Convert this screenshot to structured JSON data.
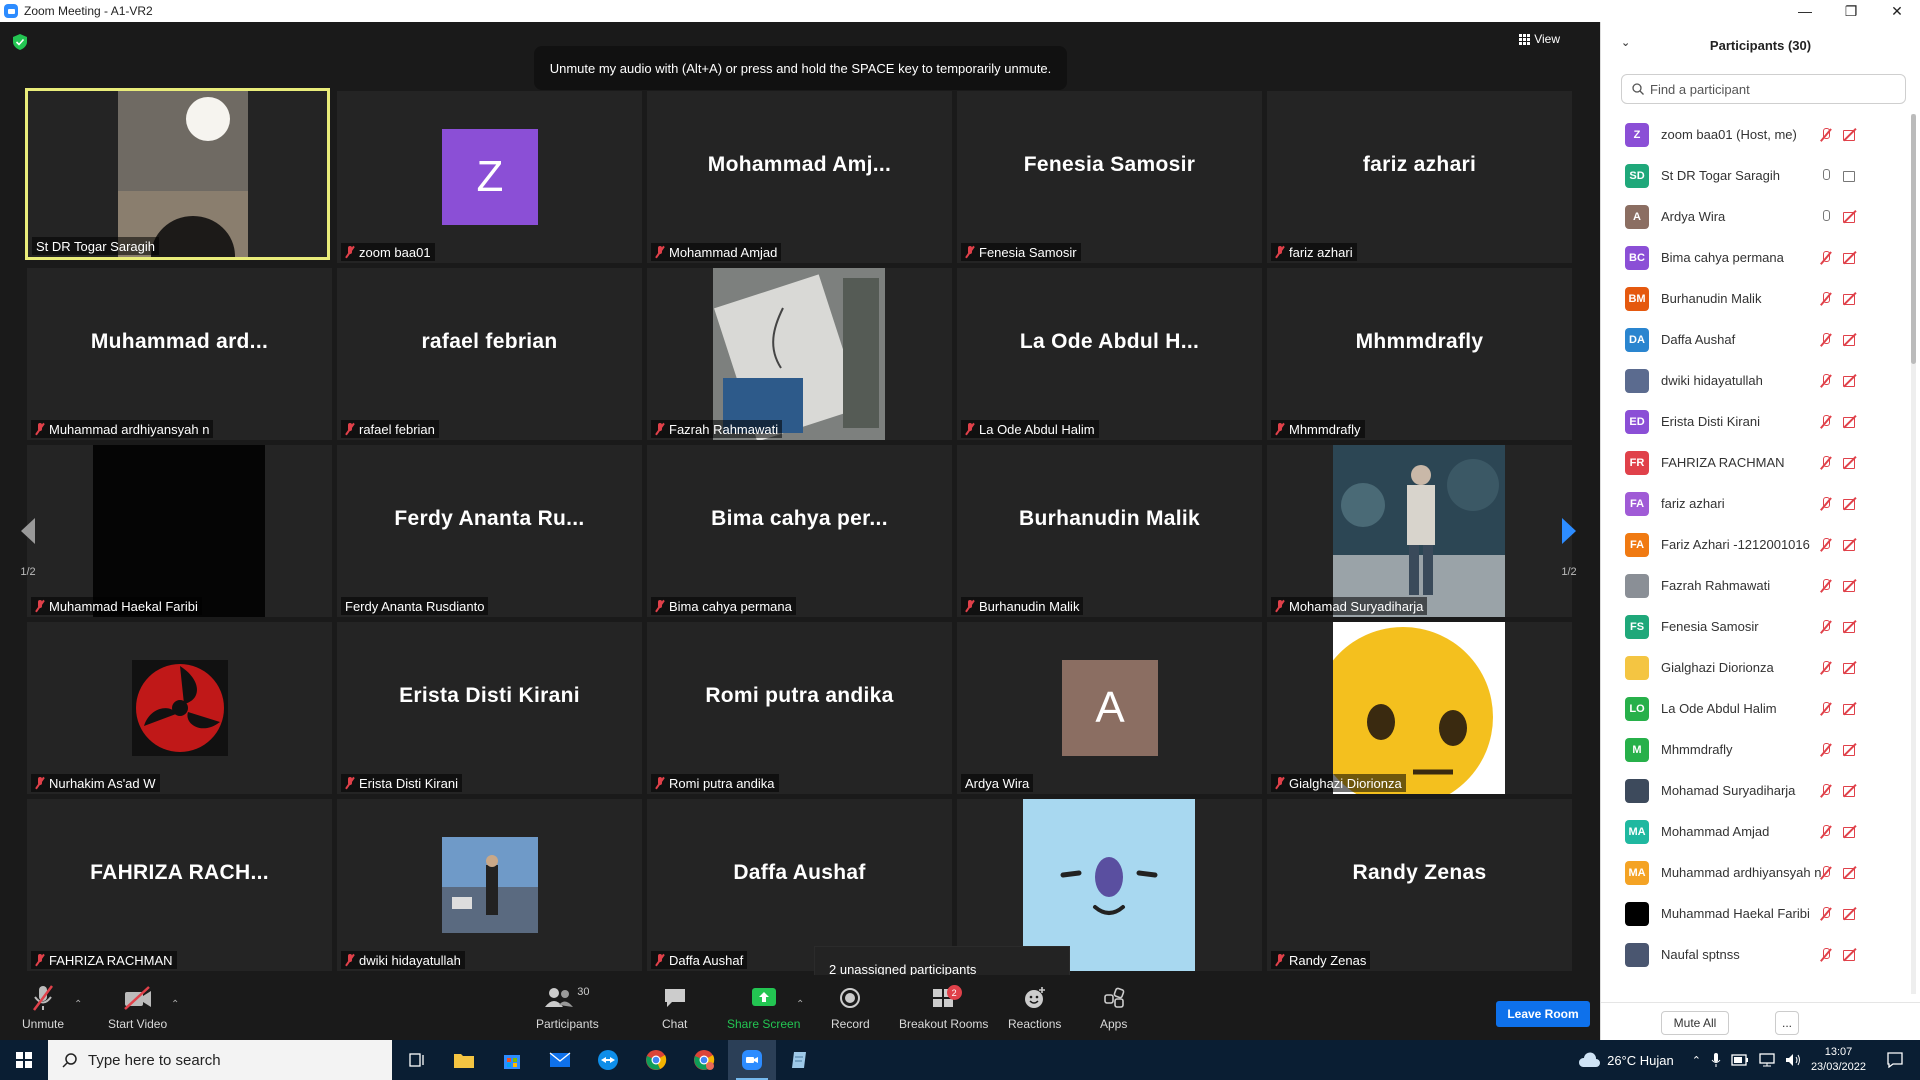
{
  "window": {
    "title": "Zoom Meeting - A1-VR2"
  },
  "stage": {
    "view_label": "View",
    "toast": "Unmute my audio with (Alt+A) or press and hold the SPACE key to temporarily unmute.",
    "page_left": "1/2",
    "page_right": "1/2",
    "unassigned": "2 unassigned participants"
  },
  "tiles": [
    {
      "big": "",
      "label": "St DR Togar Saragih",
      "muted": false
    },
    {
      "big": "",
      "avatar": "Z",
      "label": "zoom baa01",
      "muted": true
    },
    {
      "big": "Mohammad  Amj...",
      "label": "Mohammad Amjad",
      "muted": true
    },
    {
      "big": "Fenesia Samosir",
      "label": "Fenesia Samosir",
      "muted": true
    },
    {
      "big": "fariz azhari",
      "label": "fariz azhari",
      "muted": true
    },
    {
      "big": "Muhammad  ard...",
      "label": "Muhammad ardhiyansyah n",
      "muted": true
    },
    {
      "big": "rafael febrian",
      "label": "rafael febrian",
      "muted": true
    },
    {
      "big": "",
      "label": "Fazrah Rahmawati",
      "muted": true
    },
    {
      "big": "La Ode Abdul H...",
      "label": "La Ode Abdul Halim",
      "muted": true
    },
    {
      "big": "Mhmmdrafly",
      "label": "Mhmmdrafly",
      "muted": true
    },
    {
      "big": "",
      "label": "Muhammad Haekal Faribi",
      "muted": true
    },
    {
      "big": "Ferdy  Ananta  Ru...",
      "label": "Ferdy Ananta Rusdianto",
      "muted": false
    },
    {
      "big": "Bima  cahya  per...",
      "label": "Bima cahya permana",
      "muted": true
    },
    {
      "big": "Burhanudin Malik",
      "label": "Burhanudin Malik",
      "muted": true
    },
    {
      "big": "",
      "label": "Mohamad Suryadiharja",
      "muted": true
    },
    {
      "big": "",
      "label": "Nurhakim As'ad W",
      "muted": true
    },
    {
      "big": "Erista Disti Kirani",
      "label": "Erista Disti Kirani",
      "muted": true
    },
    {
      "big": "Romi putra andika",
      "label": "Romi putra andika",
      "muted": true
    },
    {
      "big": "",
      "avatar": "A",
      "label": "Ardya Wira",
      "muted": false
    },
    {
      "big": "",
      "label": "Gialghazi Diorionza",
      "muted": true
    },
    {
      "big": "FAHRIZA  RACH...",
      "label": "FAHRIZA RACHMAN",
      "muted": true
    },
    {
      "big": "",
      "label": "dwiki hidayatullah",
      "muted": true
    },
    {
      "big": "Daffa Aushaf",
      "label": "Daffa Aushaf",
      "muted": true
    },
    {
      "big": "",
      "label": "",
      "muted": false
    },
    {
      "big": "Randy Zenas",
      "label": "Randy Zenas",
      "muted": true
    }
  ],
  "toolbar": {
    "unmute": "Unmute",
    "start_video": "Start Video",
    "participants": "Participants",
    "participants_count": "30",
    "chat": "Chat",
    "share_screen": "Share Screen",
    "record": "Record",
    "breakout_rooms": "Breakout Rooms",
    "breakout_badge": "2",
    "reactions": "Reactions",
    "apps": "Apps",
    "leave_room": "Leave Room"
  },
  "panel": {
    "title": "Participants (30)",
    "search_placeholder": "Find a participant",
    "mute_all": "Mute All",
    "more": "...",
    "participants": [
      {
        "initials": "Z",
        "name": "zoom baa01 (Host, me)",
        "color": "#8b4fd6",
        "mic": "off",
        "cam": "off"
      },
      {
        "initials": "SD",
        "name": "St DR Togar Saragih",
        "color": "#1fa87a",
        "mic": "on",
        "cam": "on"
      },
      {
        "initials": "A",
        "name": "Ardya Wira",
        "color": "#8b6e62",
        "mic": "on",
        "cam": "off"
      },
      {
        "initials": "BC",
        "name": "Bima cahya permana",
        "color": "#8b4fd6",
        "mic": "off",
        "cam": "off"
      },
      {
        "initials": "BM",
        "name": "Burhanudin Malik",
        "color": "#e5590f",
        "mic": "off",
        "cam": "off"
      },
      {
        "initials": "DA",
        "name": "Daffa Aushaf",
        "color": "#2a85cf",
        "mic": "off",
        "cam": "off"
      },
      {
        "initials": "",
        "name": "dwiki hidayatullah",
        "color": "#5b6b8f",
        "mic": "off",
        "cam": "off"
      },
      {
        "initials": "ED",
        "name": "Erista Disti Kirani",
        "color": "#8b4fd6",
        "mic": "off",
        "cam": "off"
      },
      {
        "initials": "FR",
        "name": "FAHRIZA RACHMAN",
        "color": "#e0414a",
        "mic": "off",
        "cam": "off"
      },
      {
        "initials": "FA",
        "name": "fariz azhari",
        "color": "#a05bd6",
        "mic": "off",
        "cam": "off"
      },
      {
        "initials": "FA",
        "name": "Fariz Azhari -1212001016",
        "color": "#f07a12",
        "mic": "off",
        "cam": "off"
      },
      {
        "initials": "",
        "name": "Fazrah Rahmawati",
        "color": "#8a8f96",
        "mic": "off",
        "cam": "off"
      },
      {
        "initials": "FS",
        "name": "Fenesia Samosir",
        "color": "#1fa87a",
        "mic": "off",
        "cam": "off"
      },
      {
        "initials": "",
        "name": "Gialghazi Diorionza",
        "color": "#f4c542",
        "mic": "off",
        "cam": "off"
      },
      {
        "initials": "LO",
        "name": "La Ode Abdul Halim",
        "color": "#27b04a",
        "mic": "off",
        "cam": "off"
      },
      {
        "initials": "M",
        "name": "Mhmmdrafly",
        "color": "#27b04a",
        "mic": "off",
        "cam": "off"
      },
      {
        "initials": "",
        "name": "Mohamad Suryadiharja",
        "color": "#3d4a5c",
        "mic": "off",
        "cam": "off"
      },
      {
        "initials": "MA",
        "name": "Mohammad Amjad",
        "color": "#1fb8a0",
        "mic": "off",
        "cam": "off"
      },
      {
        "initials": "MA",
        "name": "Muhammad ardhiyansyah n",
        "color": "#f4a324",
        "mic": "off",
        "cam": "off"
      },
      {
        "initials": "",
        "name": "Muhammad Haekal Faribi",
        "color": "#000000",
        "mic": "off",
        "cam": "off"
      },
      {
        "initials": "",
        "name": "Naufal sptnss",
        "color": "#4a5670",
        "mic": "off",
        "cam": "off"
      }
    ]
  },
  "taskbar": {
    "search_placeholder": "Type here to search",
    "weather": "26°C  Hujan",
    "time": "13:07",
    "date": "23/03/2022"
  }
}
